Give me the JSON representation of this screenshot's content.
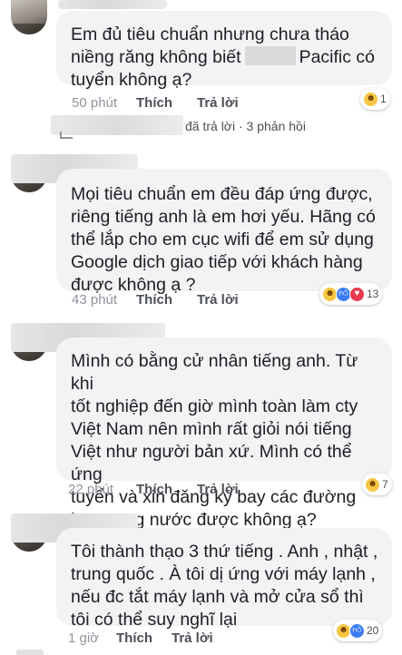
{
  "comments": [
    {
      "text_before": "Em đủ tiêu chuẩn nhưng chưa tháo\nniềng răng không biết",
      "text_after": "Pacific có\ntuyển không ạ?",
      "time": "50 phút",
      "like_label": "Thích",
      "reply_label": "Trả lời",
      "reaction_count": "1"
    },
    {
      "text": "Mọi tiêu chuẩn em đều đáp ứng được,\nriêng tiếng anh là em hơi yếu. Hãng có\nthể lắp cho em cục wifi  để em sử dụng\nGoogle dịch giao tiếp với khách hàng\nđược không ạ ?",
      "time": "43 phút",
      "like_label": "Thích",
      "reply_label": "Trả lời",
      "reaction_count": "13"
    },
    {
      "text": "Mình có bằng cử nhân tiếng anh. Từ khi\ntốt nghiệp đến giờ mình toàn làm cty\nViệt Nam nên mình rất giỏi nói tiếng\nViệt như người bản xứ. Mình có thể ứng\ntuyển và xin đăng ký bay các đường\nbay trong nước được không ạ?",
      "time": "22 phút",
      "like_label": "Thích",
      "reply_label": "Trả lời",
      "reaction_count": "7"
    },
    {
      "text": "Tôi thành thạo 3 thứ tiếng . Anh , nhật ,\ntrung quốc . À tôi dị ứng với máy lạnh ,\nnếu đc tắt máy lạnh và mở cửa sổ thì\ntôi có thể suy nghĩ lại",
      "time": "1 giờ",
      "like_label": "Thích",
      "reply_label": "Trả lời",
      "reaction_count": "20"
    }
  ],
  "reply_summary": "đã trả lời · 3 phản hồi",
  "reaction_icons": {
    "haha": "haha-emoji",
    "like": "like-emoji",
    "love": "love-emoji"
  },
  "colors": {
    "bubble": "#f2f3f5",
    "meta_text": "#90949c",
    "action_link": "#4b4f56",
    "like_blue": "#3b7cf5",
    "love_red": "#e8384f",
    "haha_yellow": "#f7c643"
  }
}
